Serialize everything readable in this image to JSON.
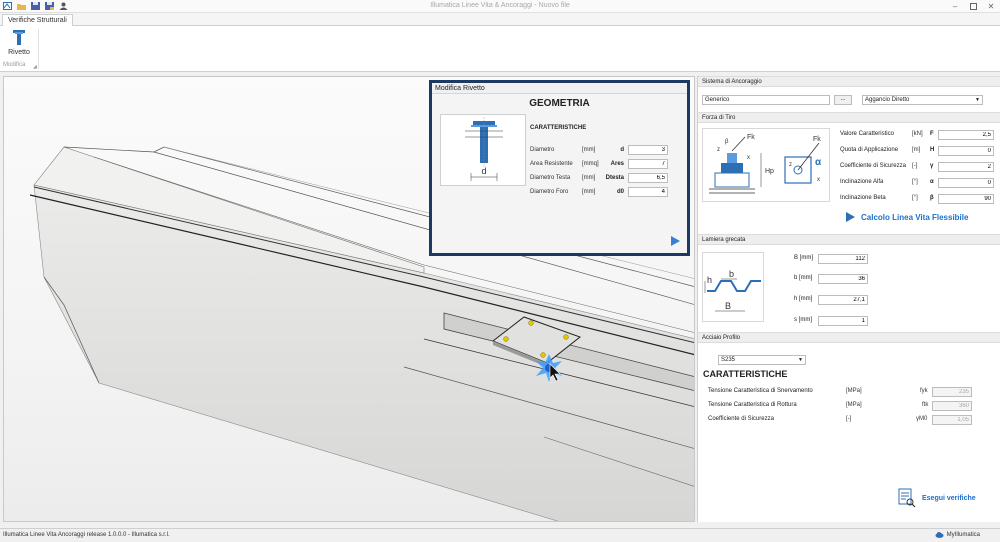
{
  "window": {
    "title": "Illumatica Linee Vita & Ancoraggi - Nuovo file"
  },
  "ribbon": {
    "tab": "Verifiche Strutturali",
    "button_label": "Rivetto",
    "group_label": "Modifica"
  },
  "dialog": {
    "title": "Modifica Rivetto",
    "heading": "GEOMETRIA",
    "subheading": "CARATTERISTICHE",
    "image_label": "d",
    "rows": [
      {
        "label": "Diametro",
        "unit": "[mm]",
        "symbol": "d",
        "value": "3"
      },
      {
        "label": "Area Resistente",
        "unit": "[mmq]",
        "symbol": "Ares",
        "value": "7"
      },
      {
        "label": "Diametro Testa",
        "unit": "[mm]",
        "symbol": "Dtesta",
        "value": "6,5"
      },
      {
        "label": "Diametro Foro",
        "unit": "[mm]",
        "symbol": "d0",
        "value": "4"
      }
    ]
  },
  "panel": {
    "anchor_section": "Sistema di Ancoraggio",
    "anchor_value": "Generico",
    "browse_label": "...",
    "anchor_type": "Aggancio Diretto",
    "force_section": "Forza di Tiro",
    "force_rows": [
      {
        "label": "Valore Caratteristico",
        "unit": "[kN]",
        "symbol": "F",
        "value": "2,5"
      },
      {
        "label": "Quota di Applicazione",
        "unit": "[m]",
        "symbol": "H",
        "value": "0"
      },
      {
        "label": "Coefficiente di Sicurezza",
        "unit": "[-]",
        "symbol": "γ",
        "value": "2"
      },
      {
        "label": "Inclinazione Alfa",
        "unit": "[°]",
        "symbol": "α",
        "value": "0"
      },
      {
        "label": "Inclinazione Beta",
        "unit": "[°]",
        "symbol": "β",
        "value": "90"
      }
    ],
    "calc_label": "Calcolo Linea Vita Flessibile",
    "sheet_section": "Lamiera grecata",
    "sheet_rows": [
      {
        "label": "B [mm]",
        "value": "112"
      },
      {
        "label": "b [mm]",
        "value": "36"
      },
      {
        "label": "h [mm]",
        "value": "27,1"
      },
      {
        "label": "s [mm]",
        "value": "1"
      }
    ],
    "steel_section": "Acciaio Profilo",
    "steel_grade": "S235",
    "char_title": "CARATTERISTICHE",
    "steel_rows": [
      {
        "label": "Tensione Caratteristica di Snervamento",
        "unit": "[MPa]",
        "symbol": "fyk",
        "value": "235"
      },
      {
        "label": "Tensione Caratteristica di Rottura",
        "unit": "[MPa]",
        "symbol": "ftk",
        "value": "360"
      },
      {
        "label": "Coefficiente di Sicurezza",
        "unit": "[-]",
        "symbol": "γM0",
        "value": "1,05"
      }
    ],
    "exec_label": "Esegui verifiche"
  },
  "status": {
    "text": "Illumatica Linee Vita  Ancoraggi release 1.0.0.0 - Illumatica s.r.l.",
    "account": "MyIllumatica"
  },
  "images": {
    "rivet_labels": {
      "d": "d"
    },
    "force_labels": {
      "Fk": "Fk",
      "beta": "β",
      "z": "z",
      "x": "x",
      "Hp": "Hp",
      "alpha": "α"
    },
    "sheet_labels": {
      "h": "h",
      "b": "b",
      "B": "B"
    }
  },
  "colors": {
    "accent": "#1e6fc9",
    "dialog_border": "#1b3a63",
    "diagram_blue": "#2d6fb5"
  }
}
